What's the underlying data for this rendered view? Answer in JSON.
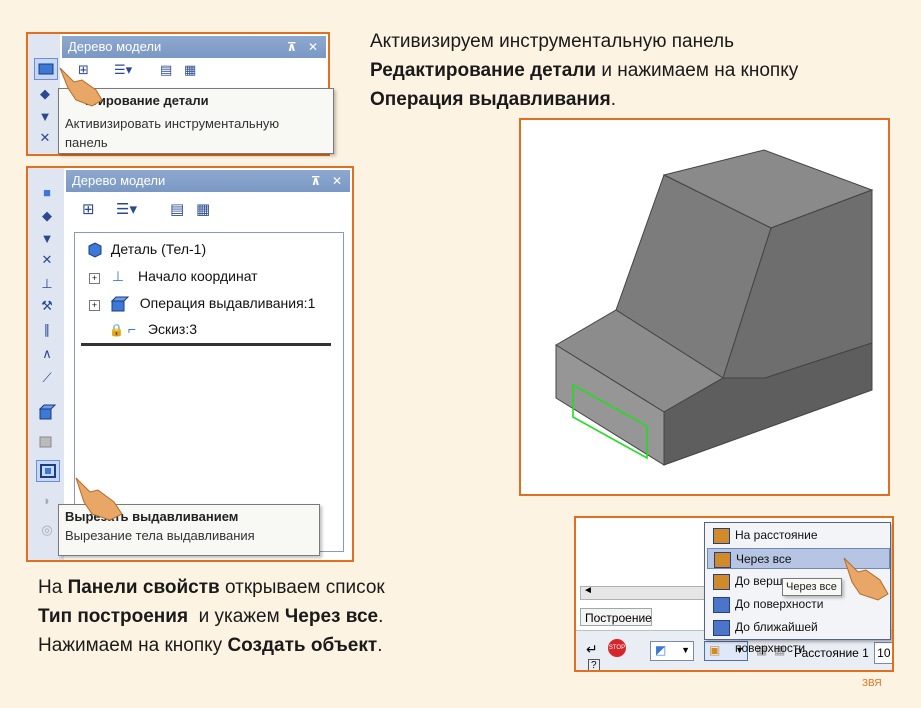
{
  "slide": {
    "instruction_top": {
      "line1": "Активизируем инструментальную панель",
      "line2_bold": "Редактирование детали",
      "line2_rest": " и нажимаем на кнопку",
      "line3_bold": "Операция выдавливания",
      "line3_rest": "."
    },
    "instruction_bottom": {
      "l1_pre": "На ",
      "l1_bold": "Панели свойств",
      "l1_rest": " открываем список",
      "l2_bold1": "Тип построения",
      "l2_mid": "  и укажем ",
      "l2_bold2": "Через все",
      "l2_rest": ".",
      "l3_pre": "Нажимаем на кнопку ",
      "l3_bold": "Создать объект",
      "l3_rest": "."
    },
    "author": "ЗВЯ"
  },
  "panel_small": {
    "title": "Дерево модели",
    "pin": "⊼",
    "close": "✕",
    "tooltip_title": "Редактирование детали",
    "tooltip_title_visible": "ктирование детали",
    "tooltip_desc_line1": "Активизировать инструментальную",
    "tooltip_desc_line2": "панель"
  },
  "panel_large": {
    "title": "Дерево модели",
    "pin": "⊼",
    "close": "✕",
    "tree": {
      "root": "Деталь (Тел-1)",
      "items": [
        {
          "label": "Начало координат"
        },
        {
          "label": "Операция выдавливания:1"
        },
        {
          "label": "Эскиз:3"
        }
      ]
    },
    "tooltip_title": "Вырезать выдавливанием",
    "tooltip_title_visible": "Вырезать выдавливанием",
    "tooltip_desc": "Вырезание тела выдавливания"
  },
  "property_panel": {
    "tab": "Построение",
    "menu": [
      "На расстояние",
      "Через все",
      "До вершины",
      "До поверхности",
      "До ближайшей поверхности"
    ],
    "menu_selected_index": 1,
    "tooltip": "Через все",
    "distance_label": "Расстояние 1",
    "distance_value": "10"
  },
  "colors": {
    "frame_accent": "#e07020",
    "title_bar": "#7a98c4",
    "highlight": "#b6c5e3",
    "sketch_outline": "#22dd22"
  }
}
